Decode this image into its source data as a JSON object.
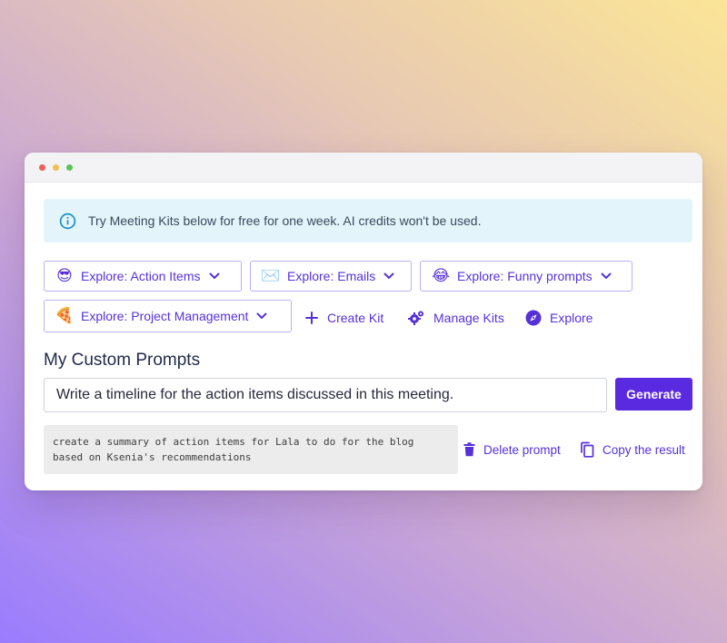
{
  "banner": {
    "text": "Try Meeting Kits below for free for one week. AI credits won't be used.",
    "icon": "info-icon",
    "color": "#1a8fc6"
  },
  "kits": [
    {
      "emoji": "😎",
      "label": "Explore: Action Items"
    },
    {
      "emoji": "✉️",
      "label": "Explore: Emails"
    },
    {
      "emoji": "😂",
      "label": "Explore: Funny prompts"
    },
    {
      "emoji": "🍕",
      "label": "Explore: Project Management"
    }
  ],
  "actions": {
    "create_kit": "Create Kit",
    "manage_kits": "Manage Kits",
    "explore": "Explore"
  },
  "custom_prompts": {
    "title": "My Custom Prompts",
    "input_value": "Write a timeline for the action items discussed in this meeting.",
    "generate_label": "Generate",
    "saved_prompt": "create a summary of action items for Lala to do for the blog\nbased on Ksenia's recommendations",
    "delete_label": "Delete prompt",
    "copy_label": "Copy the result"
  },
  "colors": {
    "accent": "#5631d8",
    "button": "#5a2ae0",
    "banner_bg": "#e3f4fb"
  }
}
